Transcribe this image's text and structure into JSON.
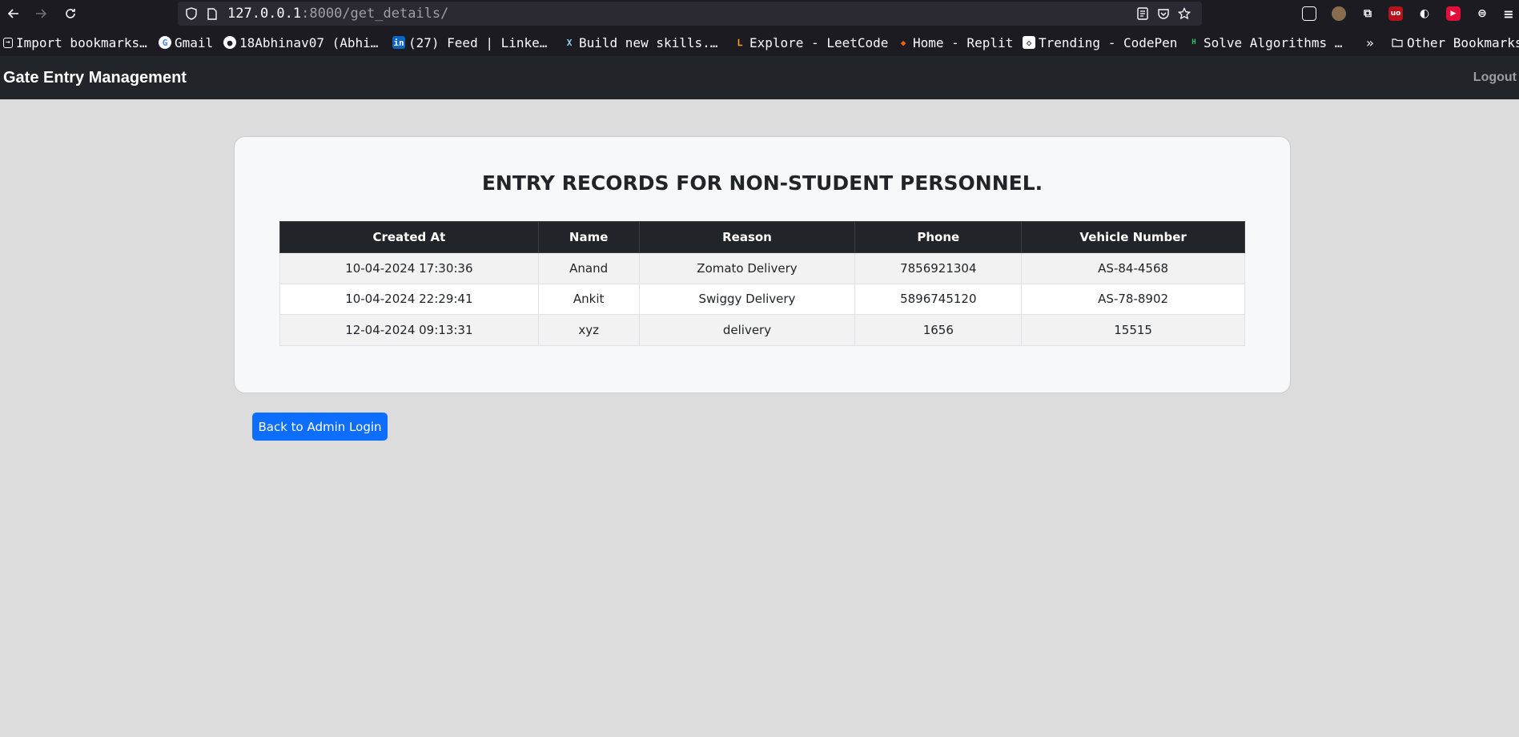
{
  "browser": {
    "url_host": "127.0.0.1",
    "url_port": ":8000",
    "url_path": "/get_details/",
    "bookmarks": [
      {
        "label": "Import bookmarks…",
        "icon": "import-icon"
      },
      {
        "label": "Gmail",
        "icon": "google-icon"
      },
      {
        "label": "18Abhinav07 (Abhi…",
        "icon": "github-icon"
      },
      {
        "label": "(27) Feed | Linke…",
        "icon": "linkedin-icon"
      },
      {
        "label": "Build new skills.…",
        "icon": "x-icon"
      },
      {
        "label": "Explore - LeetCode",
        "icon": "leetcode-icon"
      },
      {
        "label": "Home - Replit",
        "icon": "replit-icon"
      },
      {
        "label": "Trending - CodePen",
        "icon": "codepen-icon"
      },
      {
        "label": "Solve Algorithms …",
        "icon": "hackerrank-icon"
      }
    ],
    "overflow_label": "»",
    "other_bookmarks_label": "Other Bookmarks"
  },
  "navbar": {
    "brand": "Gate Entry Management",
    "logout_label": "Logout"
  },
  "main": {
    "title": "ENTRY RECORDS FOR NON-STUDENT PERSONNEL.",
    "table": {
      "headers": [
        "Created At",
        "Name",
        "Reason",
        "Phone",
        "Vehicle Number"
      ],
      "rows": [
        [
          "10-04-2024 17:30:36",
          "Anand",
          "Zomato Delivery",
          "7856921304",
          "AS-84-4568"
        ],
        [
          "10-04-2024 22:29:41",
          "Ankit",
          "Swiggy Delivery",
          "5896745120",
          "AS-78-8902"
        ],
        [
          "12-04-2024 09:13:31",
          "xyz",
          "delivery",
          "1656",
          "15515"
        ]
      ]
    },
    "back_button_label": "Back to Admin Login"
  },
  "colors": {
    "navbar_bg": "#212529",
    "page_bg": "#dcdcdc",
    "button_primary": "#0d6efd"
  }
}
